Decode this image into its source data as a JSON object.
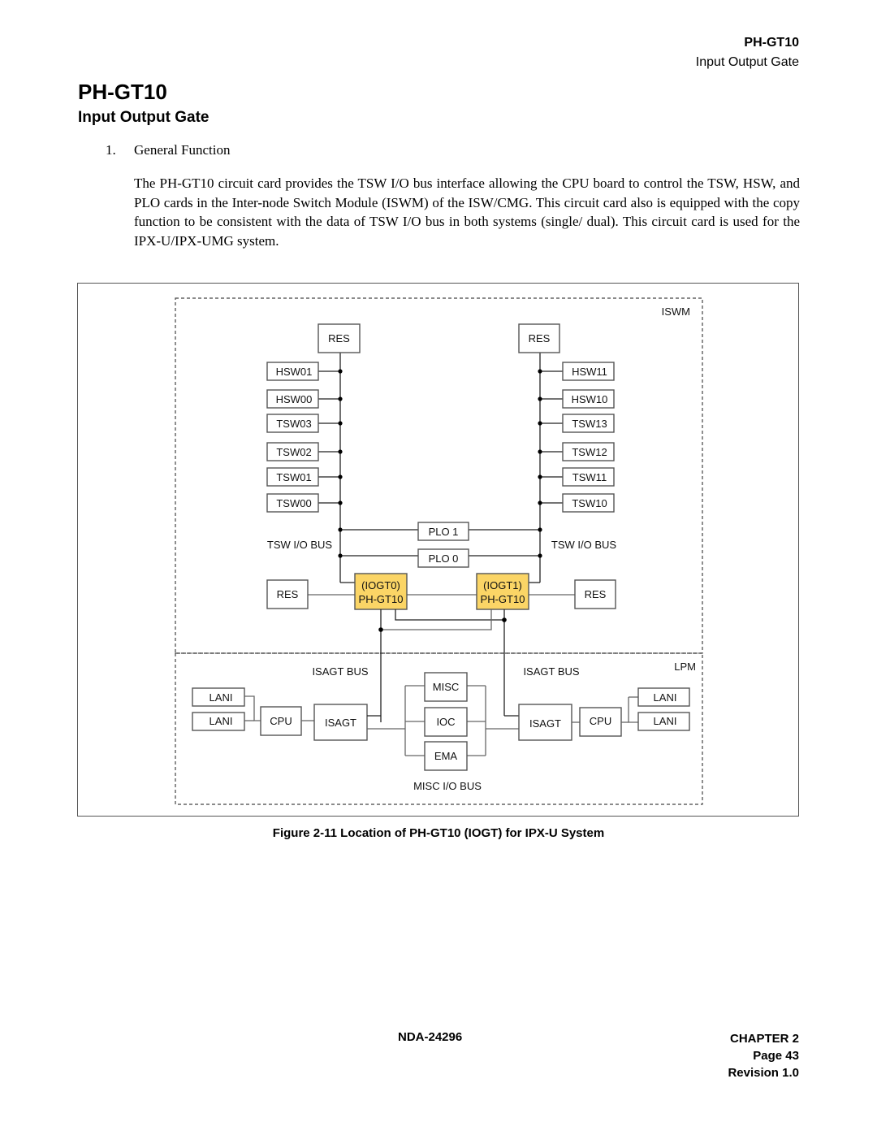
{
  "header": {
    "title": "PH-GT10",
    "subtitle": "Input Output Gate"
  },
  "page": {
    "title": "PH-GT10",
    "subtitle": "Input Output Gate"
  },
  "section": {
    "number": "1.",
    "title": "General Function",
    "paragraph": "The PH-GT10 circuit card provides the TSW I/O bus interface allowing the CPU board to control the TSW, HSW, and PLO cards in the Inter-node Switch Module (ISWM) of the ISW/CMG. This circuit card also is equipped with the copy function to be consistent with the data of TSW I/O bus in both systems (single/ dual). This circuit card is used for the IPX-U/IPX-UMG system."
  },
  "diagram": {
    "colors": {
      "gate_fill": "#fbd566",
      "line": "#222222"
    },
    "regions": {
      "upper": "ISWM",
      "lower": "LPM"
    },
    "left_column": {
      "res": "RES",
      "cards": [
        "HSW01",
        "HSW00",
        "TSW03",
        "TSW02",
        "TSW01",
        "TSW00"
      ],
      "bus_label": "TSW I/O BUS"
    },
    "right_column": {
      "res": "RES",
      "cards": [
        "HSW11",
        "HSW10",
        "TSW13",
        "TSW12",
        "TSW11",
        "TSW10"
      ],
      "bus_label": "TSW I/O BUS"
    },
    "plo": [
      "PLO 1",
      "PLO 0"
    ],
    "gates": [
      {
        "line1": "(IOGT0)",
        "line2": "PH-GT10",
        "res": "RES"
      },
      {
        "line1": "(IOGT1)",
        "line2": "PH-GT10",
        "res": "RES"
      }
    ],
    "lpm_left": {
      "bus_label": "ISAGT BUS",
      "lani": [
        "LANI",
        "LANI"
      ],
      "cpu": "CPU",
      "isagt": "ISAGT"
    },
    "lpm_right": {
      "bus_label": "ISAGT BUS",
      "lani": [
        "LANI",
        "LANI"
      ],
      "cpu": "CPU",
      "isagt": "ISAGT"
    },
    "misc_cards": [
      "MISC",
      "IOC",
      "EMA"
    ],
    "misc_bus_label": "MISC I/O BUS"
  },
  "figure": {
    "caption": "Figure 2-11   Location of PH-GT10 (IOGT) for IPX-U System"
  },
  "footer": {
    "doc_number": "NDA-24296",
    "chapter": "CHAPTER 2",
    "page": "Page 43",
    "revision": "Revision 1.0"
  }
}
